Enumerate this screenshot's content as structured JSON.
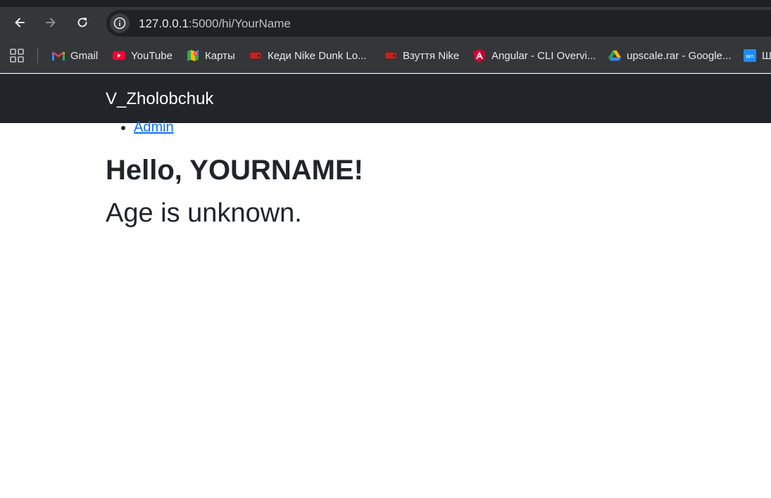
{
  "browser": {
    "url_host": "127.0.0.1",
    "url_path": ":5000/hi/YourName",
    "bookmarks": [
      {
        "label": "Gmail",
        "icon": "gmail-icon"
      },
      {
        "label": "YouTube",
        "icon": "youtube-icon"
      },
      {
        "label": "Карты",
        "icon": "maps-icon"
      },
      {
        "label": "Кеди Nike Dunk Lo...",
        "icon": "tag-icon"
      },
      {
        "label": "Взуття Nike",
        "icon": "tag-icon"
      },
      {
        "label": "Angular - CLI Overvi...",
        "icon": "angular-icon"
      },
      {
        "label": "upscale.rar - Google...",
        "icon": "google-drive-icon"
      },
      {
        "label": "Ш",
        "icon": "wn-icon"
      }
    ]
  },
  "navbar": {
    "brand": "V_Zholobchuk"
  },
  "nav_links": [
    {
      "label": "Admin"
    }
  ],
  "main": {
    "heading": "Hello, YOURNAME!",
    "age_text": "Age is unknown."
  },
  "colors": {
    "navbar_bg": "#212529",
    "link": "#0d6efd",
    "chrome_bg": "#35363a"
  }
}
